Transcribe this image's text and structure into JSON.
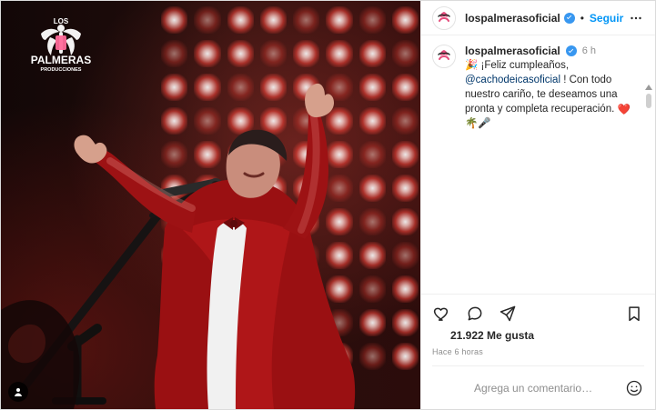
{
  "post": {
    "username": "lospalmerasoficial",
    "follow_label": "Seguir",
    "dot": "•",
    "time_ago": "6 h",
    "caption_prefix": "🎉 ¡Feliz cumpleaños,",
    "mention": "@cachodeicasoficial",
    "caption_after_mention": "! Con todo nuestro cariño, te deseamos una pronta y completa recuperación.",
    "caption_emojis_1": "❤️",
    "caption_emojis_2": "🌴🎤",
    "likes_text": "21.922 Me gusta",
    "timestamp_text": "Hace 6 horas",
    "comment_placeholder": "Agrega un comentario…"
  },
  "colors": {
    "accent_blue": "#0095f6",
    "verified_blue": "#3897f0",
    "heart_red": "#ed4956"
  },
  "icons": {
    "verified": "verified-badge-icon",
    "more": "more-options-icon",
    "like": "heart-icon",
    "comment": "comment-icon",
    "share": "send-icon",
    "save": "bookmark-icon",
    "emoji": "smile-icon",
    "user_tag": "user-icon"
  },
  "media": {
    "logo_top_text": "LOS",
    "logo_main_text": "PALMERAS",
    "logo_sub_text": "PRODUCCIONES"
  }
}
